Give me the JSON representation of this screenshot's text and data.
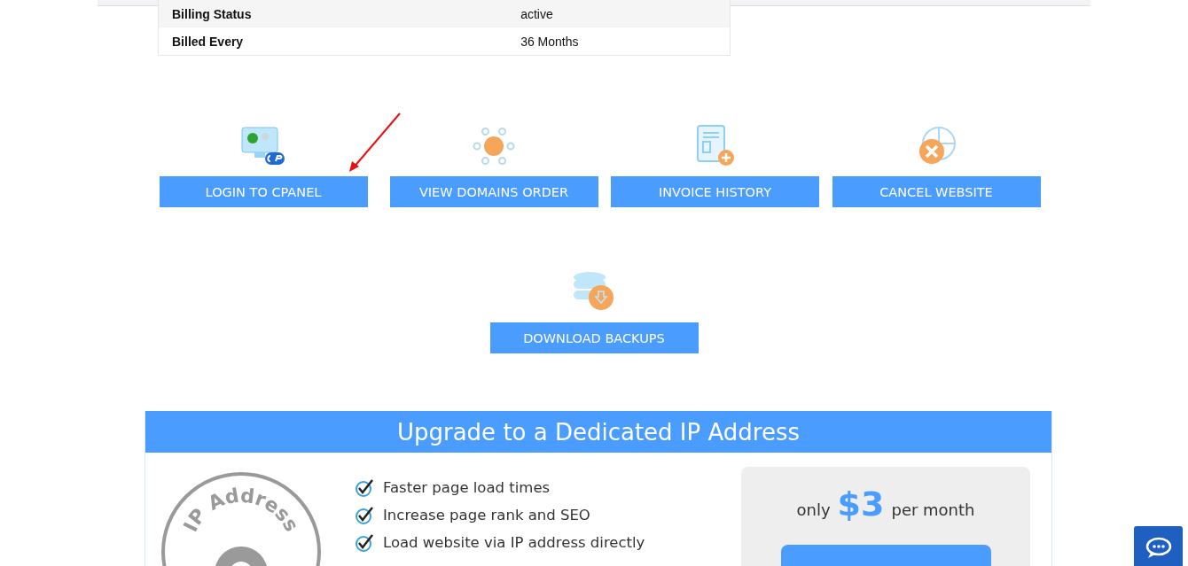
{
  "billing_table": {
    "rows": [
      {
        "label": "Billing Status",
        "value": "active"
      },
      {
        "label": "Billed Every",
        "value": "36 Months"
      }
    ]
  },
  "actions": [
    {
      "kind": "cpanel",
      "label": "LOGIN TO CPANEL"
    },
    {
      "kind": "domains",
      "label": "VIEW DOMAINS ORDER"
    },
    {
      "kind": "invoice",
      "label": "INVOICE HISTORY"
    },
    {
      "kind": "cancel",
      "label": "CANCEL WEBSITE"
    }
  ],
  "backup_action": {
    "kind": "backup",
    "label": "DOWNLOAD BACKUPS"
  },
  "upgrade": {
    "title": "Upgrade to a Dedicated IP Address",
    "badge_text": "IP Address",
    "features": [
      "Faster page load times",
      "Increase page rank and SEO",
      "Load website via IP address directly"
    ],
    "price": {
      "prefix": "only",
      "amount": "$3",
      "suffix": "per month"
    }
  }
}
